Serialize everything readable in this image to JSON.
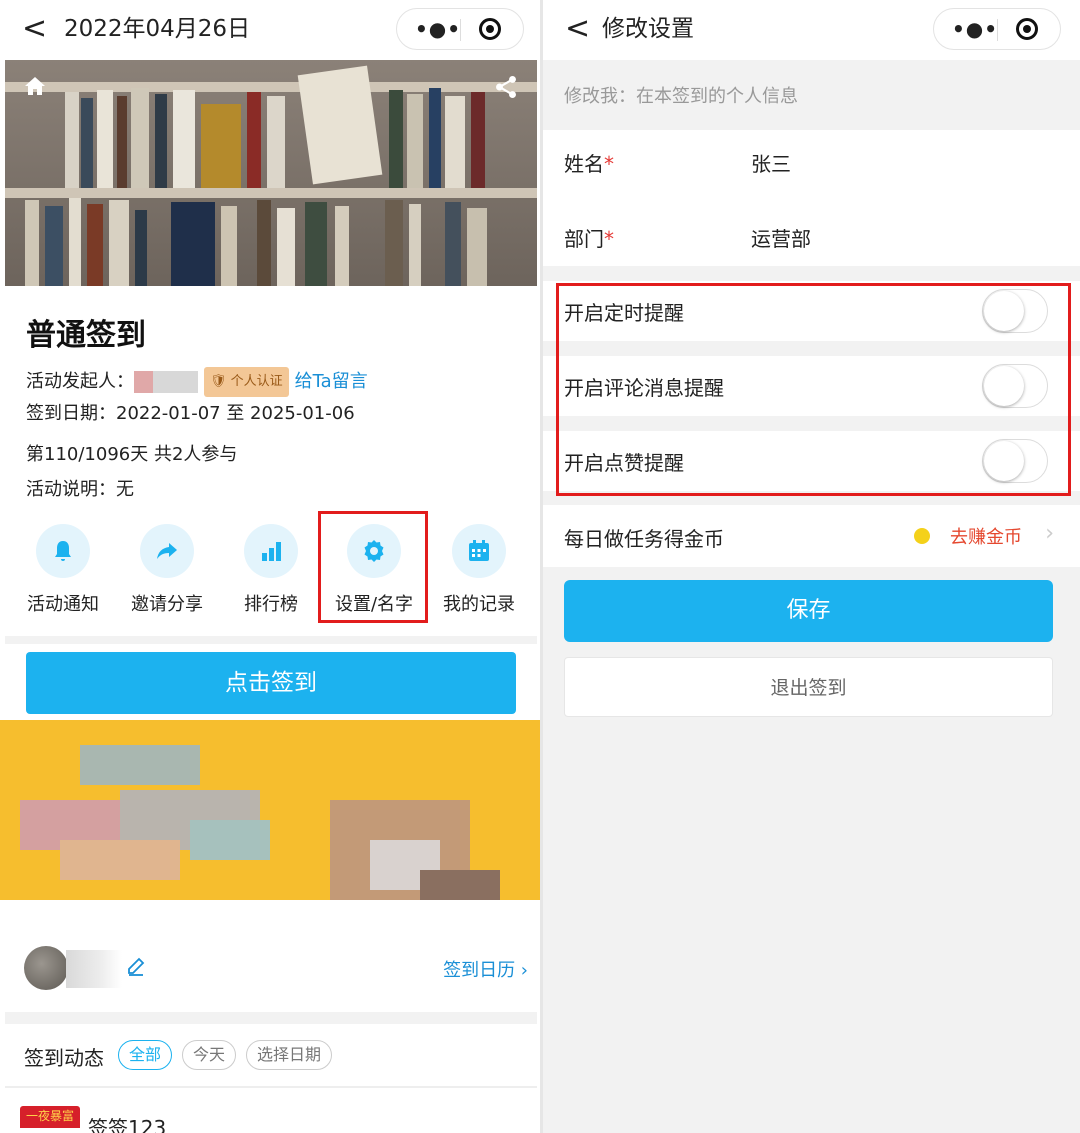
{
  "left": {
    "nav": {
      "back_glyph": "<",
      "title": "2022年04月26日",
      "more_glyph": "•●•"
    },
    "activity": {
      "title": "普通签到",
      "organizer_label": "活动发起人：",
      "badge": "个人认证",
      "leave_message": "给Ta留言",
      "date_range": "签到日期：2022-01-07 至 2025-01-06",
      "progress": "第110/1096天 共2人参与",
      "description": "活动说明：无"
    },
    "actions": [
      {
        "label": "活动通知",
        "icon": "bell-icon"
      },
      {
        "label": "邀请分享",
        "icon": "share-arrow-icon"
      },
      {
        "label": "排行榜",
        "icon": "bar-chart-icon"
      },
      {
        "label": "设置/名字",
        "icon": "gear-icon"
      },
      {
        "label": "我的记录",
        "icon": "calendar-icon"
      }
    ],
    "checkin_button": "点击签到",
    "calendar_link": "签到日历 ›",
    "feed": {
      "title": "签到动态",
      "filters": [
        "全部",
        "今天",
        "选择日期"
      ]
    },
    "post": {
      "badge": "一夜暴富",
      "name": "签签123"
    }
  },
  "right": {
    "nav": {
      "back_glyph": "<",
      "title": "修改设置",
      "more_glyph": "•●•"
    },
    "hint": "修改我：在本签到的个人信息",
    "fields": [
      {
        "label": "姓名",
        "required_mark": "*",
        "value": "张三"
      },
      {
        "label": "部门",
        "required_mark": "*",
        "value": "运营部"
      }
    ],
    "switches": [
      {
        "label": "开启定时提醒",
        "on": false
      },
      {
        "label": "开启评论消息提醒",
        "on": false
      },
      {
        "label": "开启点赞提醒",
        "on": false
      }
    ],
    "coin": {
      "label": "每日做任务得金币",
      "link": "去赚金币",
      "chevron": "›"
    },
    "save_button": "保存",
    "quit_button": "退出签到"
  },
  "colors": {
    "accent": "#1cb2ef",
    "highlight": "#e21c1c",
    "link": "#1a8fd6",
    "coin_text": "#e5482f"
  }
}
